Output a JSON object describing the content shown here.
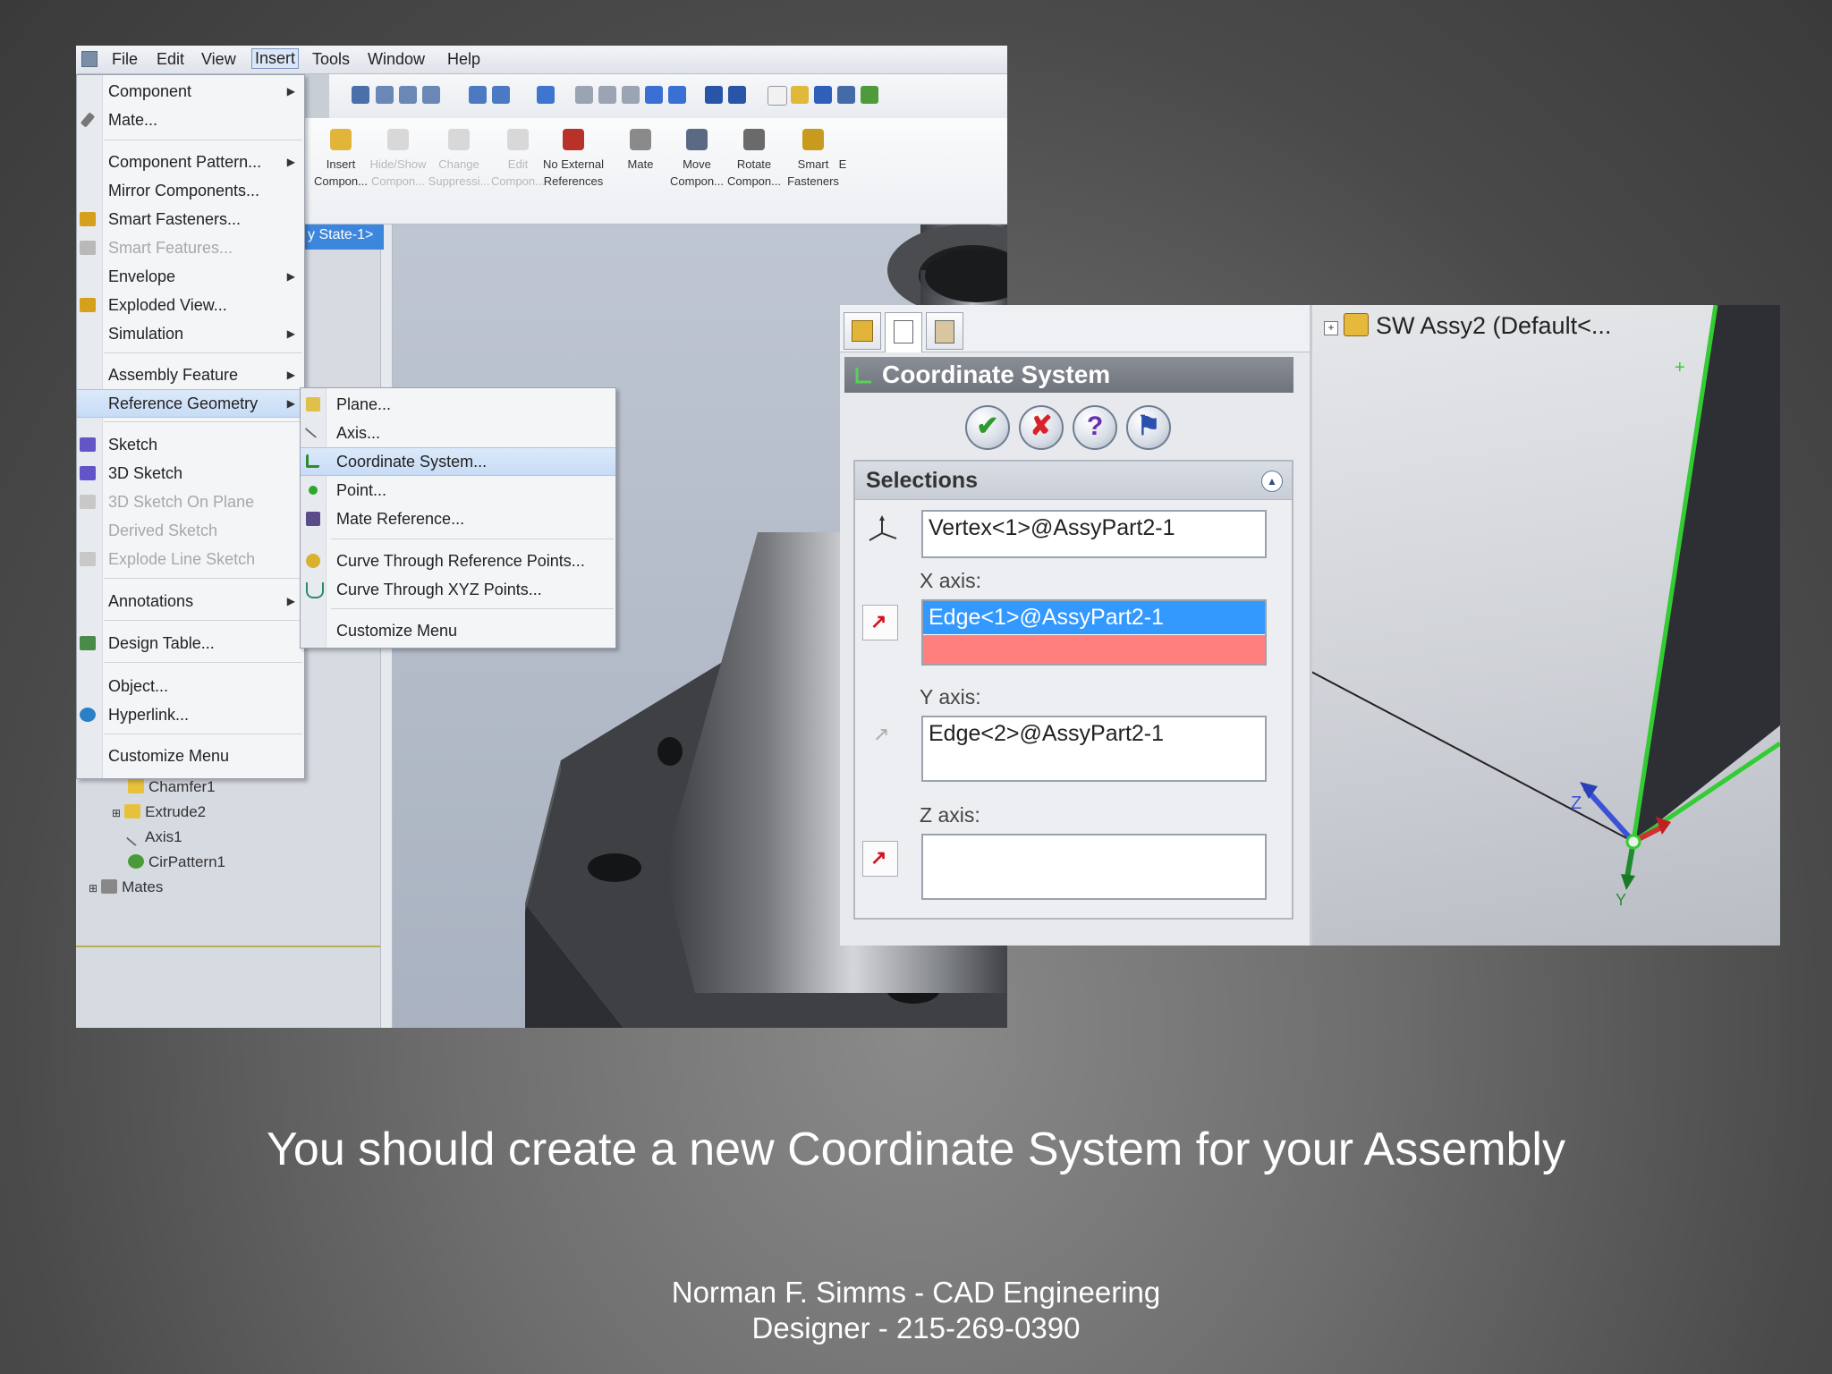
{
  "menubar": {
    "items": [
      "File",
      "Edit",
      "View",
      "Insert",
      "Tools",
      "Window",
      "Help"
    ],
    "active": "Insert"
  },
  "command_manager": {
    "items": [
      {
        "line1": "Insert",
        "line2": "Compon...",
        "icon": "insert-component-icon",
        "enabled": true
      },
      {
        "line1": "Hide/Show",
        "line2": "Compon...",
        "icon": "hide-show-icon",
        "enabled": false
      },
      {
        "line1": "Change",
        "line2": "Suppressi...",
        "icon": "change-suppression-icon",
        "enabled": false
      },
      {
        "line1": "Edit",
        "line2": "Compon...",
        "icon": "edit-component-icon",
        "enabled": false
      },
      {
        "line1": "No External",
        "line2": "References",
        "icon": "no-external-references-icon",
        "enabled": true
      },
      {
        "line1": "Mate",
        "line2": "",
        "icon": "mate-icon",
        "enabled": true
      },
      {
        "line1": "Move",
        "line2": "Compon...",
        "icon": "move-component-icon",
        "enabled": true
      },
      {
        "line1": "Rotate",
        "line2": "Compon...",
        "icon": "rotate-component-icon",
        "enabled": true
      },
      {
        "line1": "Smart",
        "line2": "Fasteners",
        "icon": "smart-fasteners-icon",
        "enabled": true
      },
      {
        "line1": "E",
        "line2": "",
        "icon": "",
        "enabled": true
      }
    ]
  },
  "config_tab": {
    "label": "y State-1>"
  },
  "insert_menu": {
    "items": {
      "component": "Component",
      "mate": "Mate...",
      "component_pattern": "Component Pattern...",
      "mirror_components": "Mirror Components...",
      "smart_fasteners": "Smart Fasteners...",
      "smart_features": "Smart Features...",
      "envelope": "Envelope",
      "exploded_view": "Exploded View...",
      "simulation": "Simulation",
      "assembly_feature": "Assembly Feature",
      "reference_geometry": "Reference Geometry",
      "sketch": "Sketch",
      "sketch_3d": "3D Sketch",
      "sketch_3d_on_plane": "3D Sketch On Plane",
      "derived_sketch": "Derived Sketch",
      "explode_line_sketch": "Explode Line Sketch",
      "annotations": "Annotations",
      "design_table": "Design Table...",
      "object": "Object...",
      "hyperlink": "Hyperlink...",
      "customize_menu": "Customize Menu"
    }
  },
  "reference_submenu": {
    "plane": "Plane...",
    "axis": "Axis...",
    "coordinate_system": "Coordinate System...",
    "point": "Point...",
    "mate_reference": "Mate Reference...",
    "curve_ref_points": "Curve Through Reference Points...",
    "curve_xyz_points": "Curve Through XYZ Points...",
    "customize_menu": "Customize Menu"
  },
  "feature_tree": {
    "items": [
      "Chamfer1",
      "Extrude2",
      "Axis1",
      "CirPattern1",
      "Mates"
    ]
  },
  "property_manager": {
    "title": "Coordinate System",
    "section": "Selections",
    "origin_value": "Vertex<1>@AssyPart2-1",
    "x_axis_label": "X axis:",
    "x_axis_value": "Edge<1>@AssyPart2-1",
    "y_axis_label": "Y axis:",
    "y_axis_value": "Edge<2>@AssyPart2-1",
    "z_axis_label": "Z axis:",
    "z_axis_value": "",
    "ok": "✔",
    "cancel": "✘",
    "help": "?",
    "pin": "⚑"
  },
  "right_view": {
    "tree_root": "SW Assy2  (Default<...",
    "axis_z": "Z",
    "axis_y": "Y"
  },
  "caption": "You should create a new Coordinate System for your Assembly",
  "credit_line1": "Norman F. Simms - CAD Engineering",
  "credit_line2": "Designer - 215-269-0390",
  "colors": {
    "selection_blue": "#3399ff",
    "selection_pink": "#ff7f7f",
    "edge_green": "#33cc33",
    "menu_highlight": "#c7dcf6"
  }
}
